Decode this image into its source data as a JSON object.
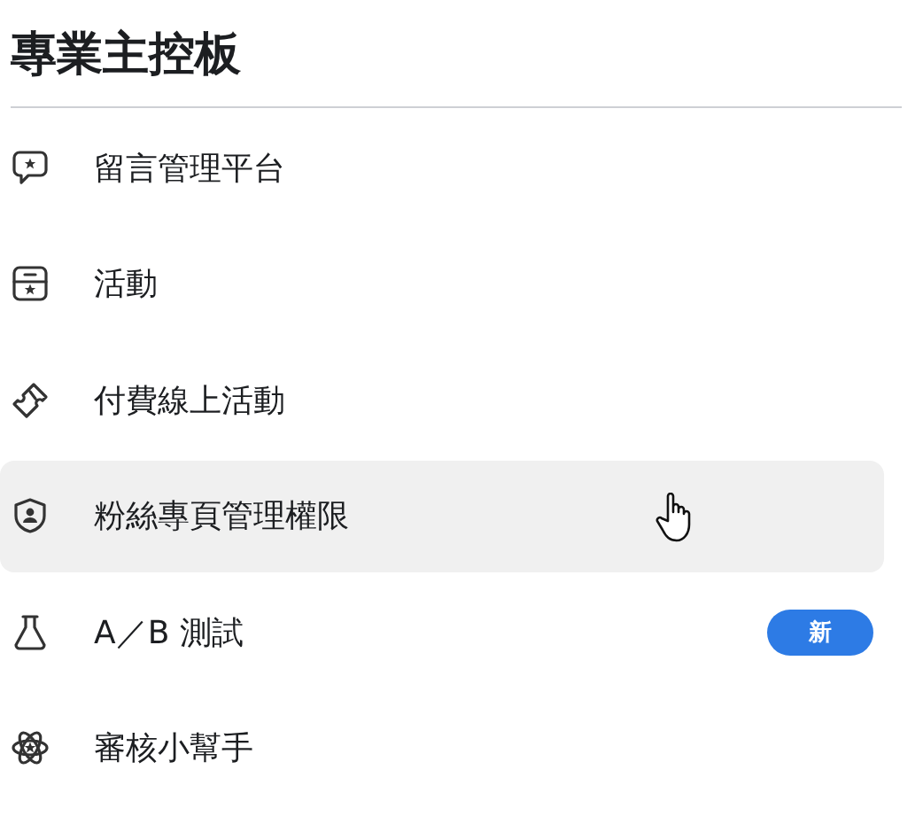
{
  "title": "專業主控板",
  "items": [
    {
      "label": "留言管理平台",
      "kind": "comment",
      "hovered": false
    },
    {
      "label": "活動",
      "kind": "calendar",
      "hovered": false
    },
    {
      "label": "付費線上活動",
      "kind": "ticket",
      "hovered": false
    },
    {
      "label": "粉絲專頁管理權限",
      "kind": "shield",
      "hovered": true
    },
    {
      "label": "A／B 測試",
      "kind": "flask",
      "hovered": false,
      "badge": "新"
    },
    {
      "label": "審核小幫手",
      "kind": "atom",
      "hovered": false
    }
  ]
}
